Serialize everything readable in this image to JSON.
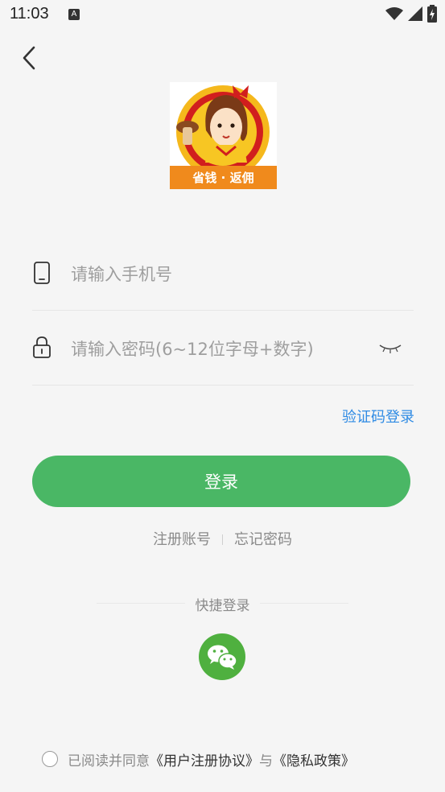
{
  "status_bar": {
    "time": "11:03",
    "app_icon_letter": "A",
    "icons": [
      "wifi-icon",
      "signal-icon",
      "battery-icon"
    ]
  },
  "logo": {
    "text": "省钱 · 返佣"
  },
  "phone_field": {
    "placeholder": "请输入手机号",
    "icon": "phone-icon"
  },
  "password_field": {
    "placeholder": "请输入密码(6~12位字母+数字)",
    "icon": "lock-icon",
    "toggle_icon": "eye-closed-icon"
  },
  "code_login_link": "验证码登录",
  "login_button": "登录",
  "links": {
    "register": "注册账号",
    "forgot": "忘记密码"
  },
  "quick_login": {
    "label": "快捷登录",
    "icon": "wechat-icon"
  },
  "agreement": {
    "prefix": "已阅读并同意",
    "user_agreement": "《用户注册协议》",
    "and": "与",
    "privacy": "《隐私政策》"
  },
  "colors": {
    "primary": "#4ab765",
    "link": "#2f8be4",
    "wechat": "#4fb03f",
    "background": "#f5f5f5"
  }
}
